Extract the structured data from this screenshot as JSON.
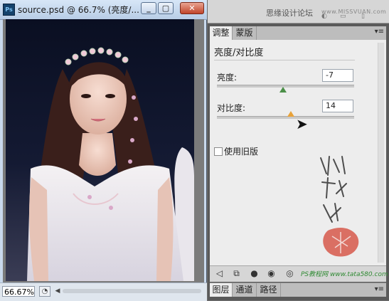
{
  "document_window": {
    "app_logo": "Ps",
    "title": "source.psd @ 66.7% (亮度/...",
    "minimize_glyph": "_",
    "maximize_glyph": "▢",
    "close_glyph": "✕",
    "zoom_value": "66.67%",
    "scroll_left_glyph": "◀"
  },
  "top_strip": {
    "watermark_text": "思缘设计论坛",
    "watermark_url": "www.MISSVUAN.com"
  },
  "adjustments_panel": {
    "tabs": [
      {
        "label": "调整",
        "active": true
      },
      {
        "label": "蒙版",
        "active": false
      }
    ],
    "menu_glyph": "▾≡",
    "heading": "亮度/对比度",
    "brightness": {
      "label": "亮度:",
      "value": "-7",
      "level_fraction": 0.48
    },
    "contrast": {
      "label": "对比度:",
      "value": "14",
      "level_fraction": 0.54
    },
    "use_legacy": {
      "label": "使用旧版",
      "checked": false
    },
    "footer_watermark": "PS教程网 www.tata580.com",
    "footer_icons": [
      "back-arrow-icon",
      "fit-window-icon",
      "clip-layer-icon",
      "visibility-icon",
      "eye-icon",
      "reset-icon",
      "delete-icon"
    ]
  },
  "layers_panel": {
    "tabs": [
      {
        "label": "图层",
        "active": true
      },
      {
        "label": "通道",
        "active": false
      },
      {
        "label": "路径",
        "active": false
      }
    ],
    "menu_glyph": "▾≡"
  },
  "colors": {
    "accent_blue": "#15436c",
    "slider_thumb": "#4b8f48",
    "slider_thumb_active": "#e8a23a",
    "seal_red": "#c0392b"
  }
}
